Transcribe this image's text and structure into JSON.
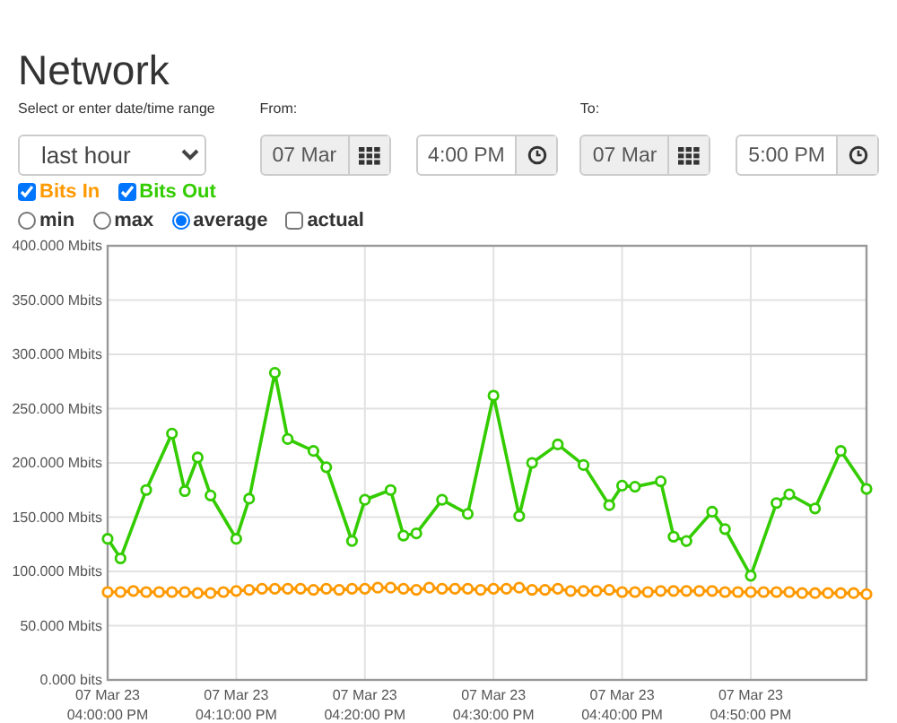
{
  "title": "Network",
  "range": {
    "label": "Select or enter date/time range",
    "value": "last hour"
  },
  "from": {
    "label": "From:",
    "date": {
      "value": "07 Mar",
      "disabled": true
    },
    "time": {
      "value": "4:00 PM",
      "disabled": false
    }
  },
  "to": {
    "label": "To:",
    "date": {
      "value": "07 Mar",
      "disabled": true
    },
    "time": {
      "value": "5:00 PM",
      "disabled": false
    }
  },
  "series_toggles": [
    {
      "checked": true
    },
    {
      "checked": true
    }
  ],
  "modes": [
    {
      "kind": "radio",
      "label": "min",
      "selected": false
    },
    {
      "kind": "radio",
      "label": "max",
      "selected": false
    },
    {
      "kind": "radio",
      "label": "average",
      "selected": true
    },
    {
      "kind": "checkbox",
      "label": "actual",
      "checked": false
    }
  ],
  "chart": {
    "chart_data": {
      "type": "line",
      "categories": [
        "07 Mar 23\n04:00:00 PM",
        null,
        null,
        null,
        null,
        null,
        null,
        null,
        null,
        null,
        "07 Mar 23\n04:10:00 PM",
        null,
        null,
        null,
        null,
        null,
        null,
        null,
        null,
        null,
        "07 Mar 23\n04:20:00 PM",
        null,
        null,
        null,
        null,
        null,
        null,
        null,
        null,
        null,
        "07 Mar 23\n04:30:00 PM",
        null,
        null,
        null,
        null,
        null,
        null,
        null,
        null,
        null,
        "07 Mar 23\n04:40:00 PM",
        null,
        null,
        null,
        null,
        null,
        null,
        null,
        null,
        null,
        "07 Mar 23\n04:50:00 PM",
        null,
        null,
        null,
        null,
        null,
        null,
        null,
        null,
        null
      ],
      "ylim": [
        0,
        400
      ],
      "grid": true,
      "yticks": [
        {
          "value": 0,
          "label": "0.000 bits"
        },
        {
          "value": 50,
          "label": "50.000 Mbits"
        },
        {
          "value": 100,
          "label": "100.000 Mbits"
        },
        {
          "value": 150,
          "label": "150.000 Mbits"
        },
        {
          "value": 200,
          "label": "200.000 Mbits"
        },
        {
          "value": 250,
          "label": "250.000 Mbits"
        },
        {
          "value": 300,
          "label": "300.000 Mbits"
        },
        {
          "value": 350,
          "label": "350.000 Mbits"
        },
        {
          "value": 400,
          "label": "400.000 Mbits"
        }
      ],
      "series": [
        {
          "name": "Bits In",
          "color": "#ff9900",
          "marker": "circle",
          "values": [
            81,
            81,
            82,
            81,
            81,
            81,
            81,
            80,
            80,
            81,
            82,
            83,
            84,
            84,
            84,
            84,
            83,
            84,
            83,
            84,
            84,
            85,
            85,
            84,
            83,
            85,
            84,
            84,
            84,
            83,
            84,
            84,
            85,
            83,
            83,
            84,
            82,
            82,
            82,
            83,
            81,
            81,
            81,
            82,
            82,
            82,
            82,
            82,
            81,
            81,
            81,
            81,
            81,
            81,
            80,
            80,
            80,
            80,
            80,
            79
          ]
        },
        {
          "name": "Bits Out",
          "color": "#33cc00",
          "marker": "circle",
          "values": [
            130,
            112,
            null,
            175,
            null,
            227,
            174,
            205,
            170,
            null,
            130,
            167,
            null,
            283,
            222,
            null,
            211,
            196,
            null,
            128,
            166,
            null,
            175,
            133,
            135,
            null,
            166,
            null,
            153,
            null,
            262,
            null,
            151,
            200,
            null,
            217,
            null,
            198,
            null,
            161,
            179,
            178,
            null,
            183,
            132,
            128,
            null,
            155,
            139,
            null,
            96,
            null,
            163,
            171,
            null,
            158,
            null,
            211,
            null,
            176
          ]
        }
      ]
    }
  }
}
